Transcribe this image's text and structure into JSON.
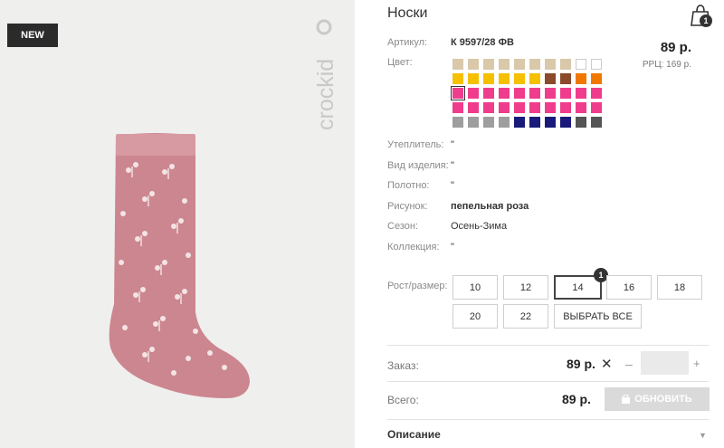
{
  "badge": {
    "new": "NEW"
  },
  "brand": {
    "logo_text": "crockid"
  },
  "product": {
    "title": "Носки",
    "article_label": "Артикул:",
    "article": "К 9597/28 ФВ",
    "price": "89 р.",
    "rrp": "РРЦ: 169 р.",
    "color_label": "Цвет:"
  },
  "cart": {
    "count": "1"
  },
  "swatches": [
    "#d9c8a9",
    "#d9c8a9",
    "#d9c8a9",
    "#d9c8a9",
    "#d9c8a9",
    "#d9c8a9",
    "#d9c8a9",
    "#d9c8a9",
    "empty",
    "empty",
    "#f5c000",
    "#f5c000",
    "#f5c000",
    "#f5c000",
    "#f5c000",
    "#f5c000",
    "#8b4a2b",
    "#8b4a2b",
    "#f07800",
    "#f07800",
    "#f03c8c",
    "#f03c8c",
    "#f03c8c",
    "#f03c8c",
    "#f03c8c",
    "#f03c8c",
    "#f03c8c",
    "#f03c8c",
    "#f03c8c",
    "#f03c8c",
    "#f03c8c",
    "#f03c8c",
    "#f03c8c",
    "#f03c8c",
    "#f03c8c",
    "#f03c8c",
    "#f03c8c",
    "#f03c8c",
    "#f03c8c",
    "#f03c8c",
    "#9e9e9e",
    "#9e9e9e",
    "#9e9e9e",
    "#9e9e9e",
    "#1a1a7a",
    "#1a1a7a",
    "#1a1a7a",
    "#1a1a7a",
    "#555555",
    "#555555"
  ],
  "attrs": [
    {
      "label": "Утеплитель:",
      "value": "\"",
      "bold": false
    },
    {
      "label": "Вид изделия:",
      "value": "\"",
      "bold": false
    },
    {
      "label": "Полотно:",
      "value": "\"",
      "bold": false
    },
    {
      "label": "Рисунок:",
      "value": "пепельная роза",
      "bold": true
    },
    {
      "label": "Сезон:",
      "value": "Осень-Зима",
      "bold": false
    },
    {
      "label": "Коллекция:",
      "value": "\"",
      "bold": false
    }
  ],
  "sizes": {
    "label": "Рост/размер:",
    "items": [
      "10",
      "12",
      "14",
      "16",
      "18",
      "20",
      "22"
    ],
    "select_all": "ВЫБРАТЬ ВСЕ",
    "active_badge": "1"
  },
  "order": {
    "label": "Заказ:",
    "price": "89 р.",
    "times": "✕",
    "minus": "–",
    "plus": "+",
    "total_label": "Всего:",
    "total": "89 р.",
    "refresh": "ОБНОВИТЬ"
  },
  "description": {
    "label": "Описание",
    "arrow": "▼"
  }
}
